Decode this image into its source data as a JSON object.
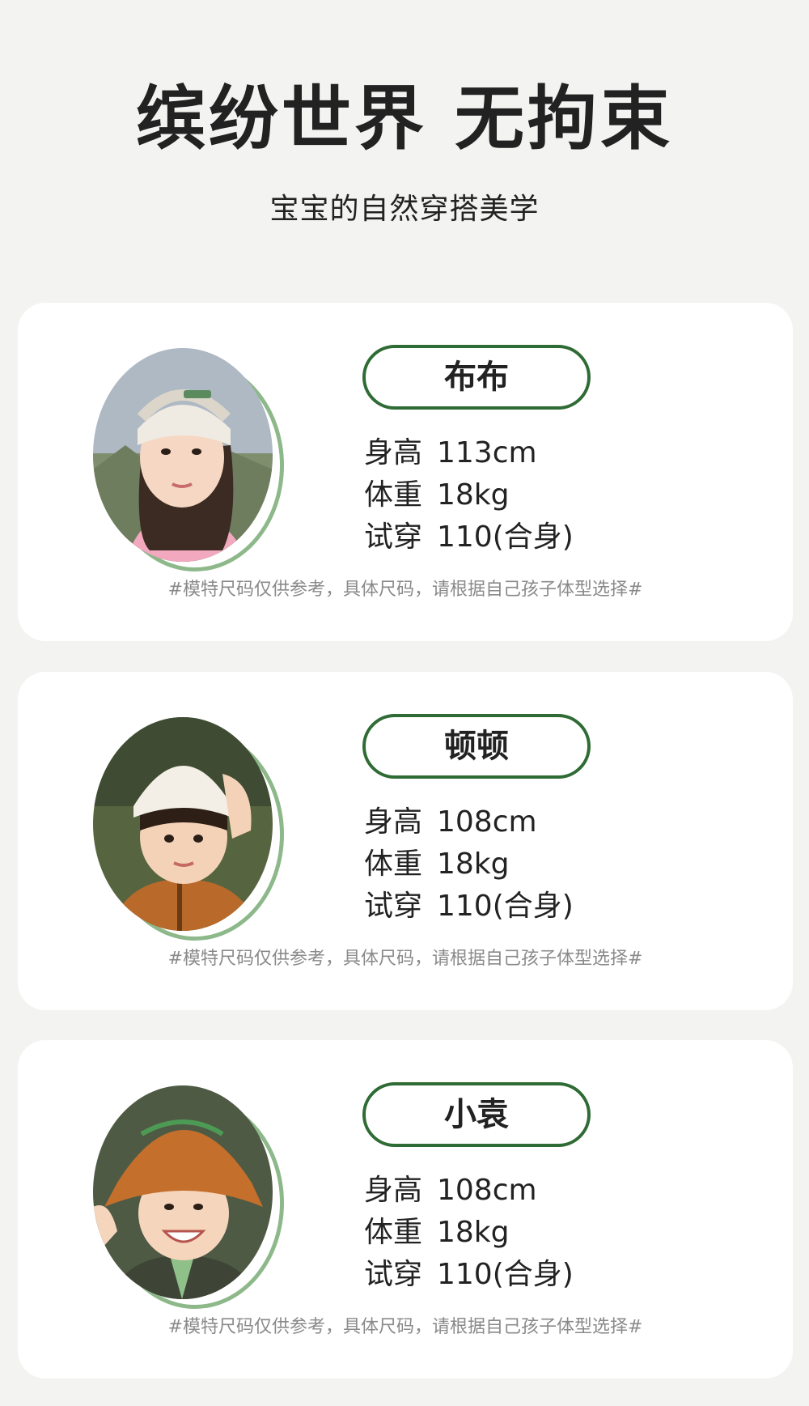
{
  "header": {
    "title": "缤纷世界 无拘束",
    "subtitle": "宝宝的自然穿搭美学"
  },
  "colors": {
    "background": "#f3f3f1",
    "card": "#ffffff",
    "accent_green": "#2f6b34",
    "ring_green": "#8db88a",
    "muted_text": "#8a8a8a"
  },
  "models": [
    {
      "name": "布布",
      "height_label": "身高",
      "height_value": "113cm",
      "weight_label": "体重",
      "weight_value": "18kg",
      "fit_label": "试穿",
      "fit_value": "110(合身)",
      "note": "#模特尺码仅供参考，具体尺码，请根据自己孩子体型选择#",
      "photo_icon": "girl-portrait-photo"
    },
    {
      "name": "顿顿",
      "height_label": "身高",
      "height_value": "108cm",
      "weight_label": "体重",
      "weight_value": "18kg",
      "fit_label": "试穿",
      "fit_value": "110(合身)",
      "note": "#模特尺码仅供参考，具体尺码，请根据自己孩子体型选择#",
      "photo_icon": "boy-beanie-portrait-photo"
    },
    {
      "name": "小袁",
      "height_label": "身高",
      "height_value": "108cm",
      "weight_label": "体重",
      "weight_value": "18kg",
      "fit_label": "试穿",
      "fit_value": "110(合身)",
      "note": "#模特尺码仅供参考，具体尺码，请根据自己孩子体型选择#",
      "photo_icon": "boy-bucket-hat-portrait-photo"
    }
  ]
}
